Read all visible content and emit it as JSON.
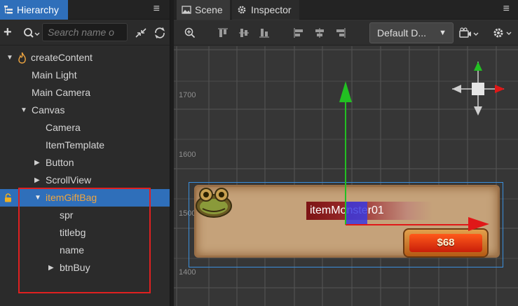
{
  "hierarchy": {
    "tab_title": "Hierarchy",
    "menu_glyph": "≡",
    "search_placeholder": "Search name o",
    "tree": [
      {
        "label": "createContent",
        "depth": 0,
        "expanded": true,
        "icon": "fire-icon"
      },
      {
        "label": "Main Light",
        "depth": 1
      },
      {
        "label": "Main Camera",
        "depth": 1
      },
      {
        "label": "Canvas",
        "depth": 1,
        "expanded": true
      },
      {
        "label": "Camera",
        "depth": 2
      },
      {
        "label": "ItemTemplate",
        "depth": 2
      },
      {
        "label": "Button",
        "depth": 2,
        "expanded": false
      },
      {
        "label": "ScrollView",
        "depth": 2,
        "expanded": false
      },
      {
        "label": "itemGiftBag",
        "depth": 2,
        "expanded": true,
        "selected": true,
        "locked": true
      },
      {
        "label": "spr",
        "depth": 3
      },
      {
        "label": "titlebg",
        "depth": 3
      },
      {
        "label": "name",
        "depth": 3
      },
      {
        "label": "btnBuy",
        "depth": 3,
        "expanded": false
      }
    ]
  },
  "scene_panel": {
    "tabs": [
      {
        "label": "Scene",
        "icon": "scene-icon",
        "active": true
      },
      {
        "label": "Inspector",
        "icon": "gear-icon",
        "active": false
      }
    ],
    "menu_glyph": "≡",
    "dropdown_value": "Default D...",
    "y_axis_labels": [
      "1700",
      "1600",
      "1500",
      "1400"
    ]
  },
  "game_card": {
    "name_text": "itemMonster01",
    "price_text": "$68"
  },
  "colors": {
    "selection": "#2f6fba",
    "selected_text": "#f0a640",
    "highlight_box": "#e02020",
    "gizmo_green": "#22c022",
    "gizmo_red": "#e01818",
    "gizmo_blue": "#3a3ae0"
  }
}
